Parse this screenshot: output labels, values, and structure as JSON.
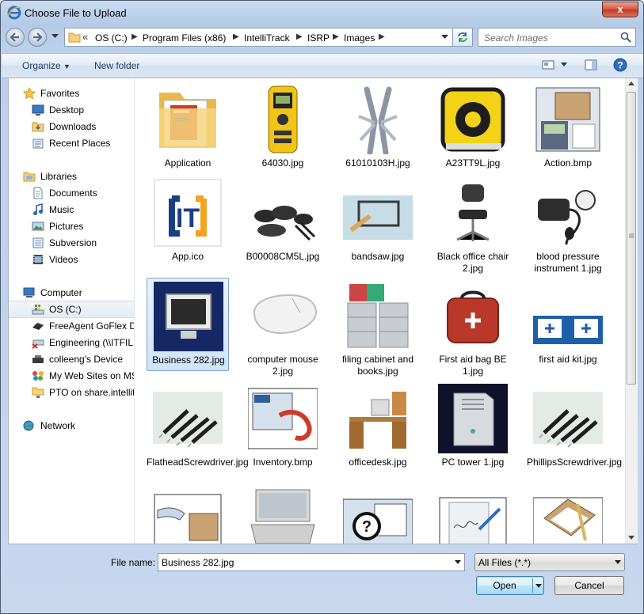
{
  "window": {
    "title": "Choose File to Upload",
    "close_label": "x"
  },
  "address": {
    "overflow": "«",
    "crumbs": [
      "OS (C:)",
      "Program Files (x86)",
      "IntelliTrack",
      "ISRP",
      "Images"
    ],
    "search_placeholder": "Search Images"
  },
  "toolbar": {
    "organize": "Organize",
    "new_folder": "New folder"
  },
  "sidebar": {
    "favorites": "Favorites",
    "favorites_items": [
      "Desktop",
      "Downloads",
      "Recent Places"
    ],
    "libraries": "Libraries",
    "libraries_items": [
      "Documents",
      "Music",
      "Pictures",
      "Subversion",
      "Videos"
    ],
    "computer": "Computer",
    "computer_items": [
      "OS (C:)",
      "FreeAgent GoFlex Dr",
      "Engineering (\\\\ITFIL",
      "colleeng's Device",
      "My Web Sites on MS",
      "PTO on share.intellit"
    ],
    "network": "Network"
  },
  "files": [
    {
      "label": "Application",
      "icon": "folder-icon"
    },
    {
      "label": "64030.jpg",
      "icon": "stud-finder-icon"
    },
    {
      "label": "61010103H.jpg",
      "icon": "multitool-icon"
    },
    {
      "label": "A23TT9L.jpg",
      "icon": "tape-measure-icon"
    },
    {
      "label": "Action.bmp",
      "icon": "action-icon"
    },
    {
      "label": "App.ico",
      "icon": "it-logo-icon"
    },
    {
      "label": "B00008CM5L.jpg",
      "icon": "cookware-icon"
    },
    {
      "label": "bandsaw.jpg",
      "icon": "bandsaw-icon"
    },
    {
      "label": "Black office chair 2.jpg",
      "icon": "office-chair-icon"
    },
    {
      "label": "blood pressure instrument 1.jpg",
      "icon": "blood-pressure-icon"
    },
    {
      "label": "Business 282.jpg",
      "icon": "monitor-icon"
    },
    {
      "label": "computer mouse 2.jpg",
      "icon": "mouse-icon"
    },
    {
      "label": "filing cabinet and books.jpg",
      "icon": "filing-cabinet-icon"
    },
    {
      "label": "First aid bag BE 1.jpg",
      "icon": "first-aid-bag-icon"
    },
    {
      "label": "first aid kit.jpg",
      "icon": "first-aid-kit-icon"
    },
    {
      "label": "FlatheadScrewdriver.jpg",
      "icon": "screwdrivers-icon"
    },
    {
      "label": "Inventory.bmp",
      "icon": "inventory-icon"
    },
    {
      "label": "officedesk.jpg",
      "icon": "office-desk-icon"
    },
    {
      "label": "PC tower 1.jpg",
      "icon": "pc-tower-icon"
    },
    {
      "label": "PhillipsScrewdriver.jpg",
      "icon": "screwdrivers-icon"
    },
    {
      "label": "",
      "icon": "box-hand-icon"
    },
    {
      "label": "",
      "icon": "laptop-icon"
    },
    {
      "label": "",
      "icon": "help-icon"
    },
    {
      "label": "",
      "icon": "signature-icon"
    },
    {
      "label": "",
      "icon": "clipboard-icon"
    }
  ],
  "footer": {
    "file_name_label": "File name:",
    "file_name_value": "Business 282.jpg",
    "file_type_value": "All Files (*.*)",
    "open_label": "Open",
    "cancel_label": "Cancel"
  }
}
